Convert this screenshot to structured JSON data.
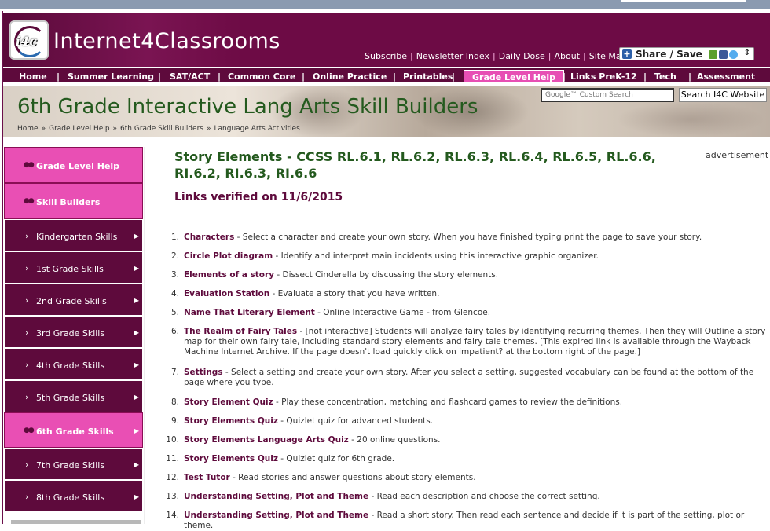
{
  "brand": {
    "logo_text": "Internet4Classrooms",
    "badge": "i4c"
  },
  "toplinks": [
    "Subscribe",
    "Newsletter Index",
    "Daily Dose",
    "About",
    "Site Map"
  ],
  "share": {
    "label": "Share / Save",
    "arrows": "⇕"
  },
  "nav": [
    "Home",
    "Summer Learning",
    "SAT/ACT",
    "Common Core",
    "Online Practice",
    "Printables",
    "Grade Level Help",
    "Links PreK-12",
    "Tech",
    "Assessment"
  ],
  "nav_active": "Grade Level Help",
  "banner": {
    "title": "6th Grade Interactive Lang Arts Skill Builders",
    "breadcrumb": [
      "Home",
      "Grade Level Help",
      "6th Grade Skill Builders",
      "Language Arts Activities"
    ],
    "search_placeholder": "Google™ Custom Search",
    "search_button": "Search I4C Website"
  },
  "sidebar": [
    {
      "label": "Grade Level Help",
      "style": "pink"
    },
    {
      "label": "Skill Builders",
      "style": "pink"
    },
    {
      "label": "Kindergarten Skills",
      "style": "dark"
    },
    {
      "label": "1st Grade Skills",
      "style": "dark"
    },
    {
      "label": "2nd Grade Skills",
      "style": "dark"
    },
    {
      "label": "3rd Grade Skills",
      "style": "dark"
    },
    {
      "label": "4th Grade Skills",
      "style": "dark"
    },
    {
      "label": "5th Grade Skills",
      "style": "dark"
    },
    {
      "label": "6th Grade Skills",
      "style": "pink"
    },
    {
      "label": "7th Grade Skills",
      "style": "dark"
    },
    {
      "label": "8th Grade Skills",
      "style": "dark"
    }
  ],
  "content": {
    "title": "Story Elements - CCSS RL.6.1, RL.6.2, RL.6.3, RL.6.4, RL.6.5, RL.6.6, RI.6.2, RI.6.3, RI.6.6",
    "advertisement": "advertisement",
    "verified": "Links verified on 11/6/2015",
    "items": [
      {
        "n": "1.",
        "title": "Characters",
        "desc": " - Select a character and create your own story. When you have finished typing print the page to save your story."
      },
      {
        "n": "2.",
        "title": "Circle Plot diagram",
        "desc": " - Identify and interpret main incidents using this interactive graphic organizer."
      },
      {
        "n": "3.",
        "title": "Elements of a story",
        "desc": " - Dissect Cinderella by discussing the story elements."
      },
      {
        "n": "4.",
        "title": "Evaluation Station",
        "desc": " - Evaluate a story that you have written."
      },
      {
        "n": "5.",
        "title": "Name That Literary Element",
        "desc": " - Online Interactive Game - from Glencoe."
      },
      {
        "n": "6.",
        "title": "The Realm of Fairy Tales",
        "desc": " - [not interactive] Students will analyze fairy tales by identifying recurring themes. Then they will Outline a story map for their own fairy tale, including standard story elements and fairy tale themes. [This expired link is available through the Wayback Machine Internet Archive. If the page doesn't load quickly click on impatient? at the bottom right of the page.]"
      },
      {
        "n": "7.",
        "title": "Settings",
        "desc": " - Select a setting and create your own story. After you select a setting, suggested vocabulary can be found at the bottom of the page where you type."
      },
      {
        "n": "8.",
        "title": "Story Element Quiz",
        "desc": " - Play these concentration, matching and flashcard games to review the definitions."
      },
      {
        "n": "9.",
        "title": "Story Elements Quiz",
        "desc": " - Quizlet quiz for advanced students."
      },
      {
        "n": "10.",
        "title": "Story Elements Language Arts Quiz",
        "desc": " - 20 online questions."
      },
      {
        "n": "11.",
        "title": "Story Elements Quiz",
        "desc": " - Quizlet quiz for 6th grade."
      },
      {
        "n": "12.",
        "title": "Test Tutor",
        "desc": " - Read stories and answer questions about story elements."
      },
      {
        "n": "13.",
        "title": "Understanding Setting, Plot and Theme",
        "desc": " - Read each description and choose the correct setting."
      },
      {
        "n": "14.",
        "title": "Understanding Setting, Plot and Theme",
        "desc": " - Read a short story. Then read each sentence and decide if it is part of the setting, plot or theme."
      }
    ]
  },
  "colors": {
    "maroon": "#5e0a3c",
    "pink": "#e94fb4",
    "green_title": "#245a1e"
  }
}
